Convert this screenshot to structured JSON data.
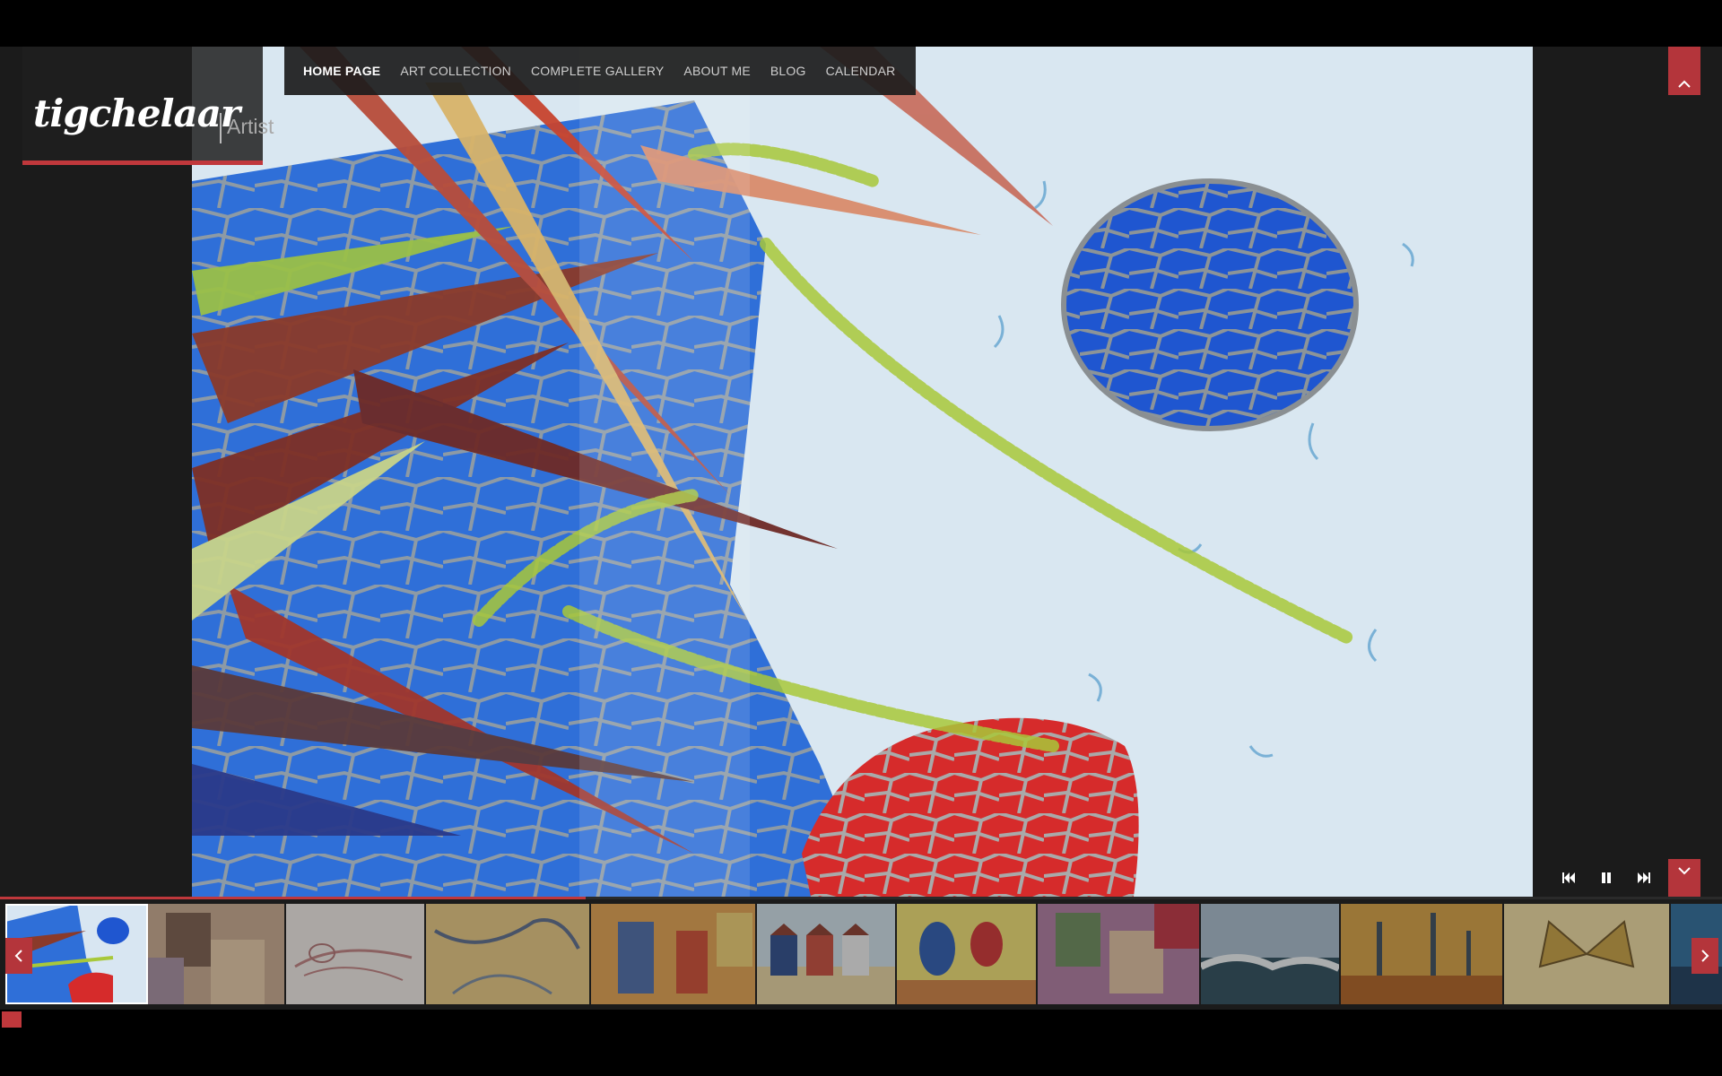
{
  "site": {
    "logo_script": "tigchelaar",
    "logo_tagline": "Artist"
  },
  "nav": {
    "items": [
      {
        "label": "HOME PAGE",
        "active": true
      },
      {
        "label": "ART COLLECTION",
        "active": false
      },
      {
        "label": "COMPLETE GALLERY",
        "active": false
      },
      {
        "label": "ABOUT ME",
        "active": false
      },
      {
        "label": "BLOG",
        "active": false
      },
      {
        "label": "CALENDAR",
        "active": false
      }
    ]
  },
  "slideshow": {
    "progress_fraction": 0.34,
    "controls": [
      "previous-icon",
      "pause-icon",
      "next-icon"
    ]
  },
  "colors": {
    "accent": "#c0383c",
    "panel": "#1b1b1b",
    "nav_bg": "#1c1c1c"
  },
  "thumbnails": [
    {
      "name": "mosaic-flowers",
      "selected": true
    },
    {
      "name": "abstract-cubes"
    },
    {
      "name": "reclining-figure-sketch"
    },
    {
      "name": "yellow-abstract-lines"
    },
    {
      "name": "figures-warm-tones"
    },
    {
      "name": "beach-huts"
    },
    {
      "name": "colorful-trees"
    },
    {
      "name": "cubist-figures"
    },
    {
      "name": "ocean-wave"
    },
    {
      "name": "trees-in-field"
    },
    {
      "name": "butterfly"
    },
    {
      "name": "blue-partial"
    }
  ]
}
